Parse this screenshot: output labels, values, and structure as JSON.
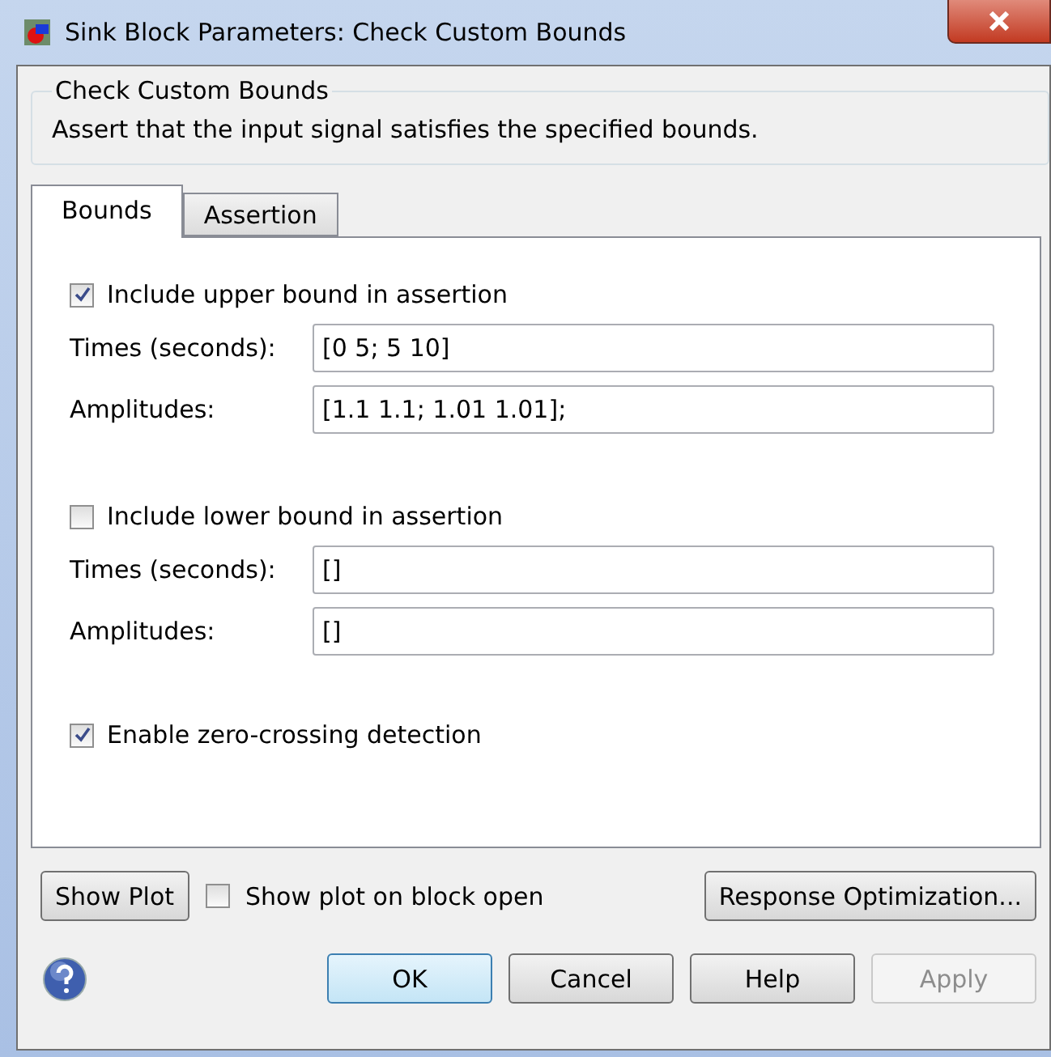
{
  "window": {
    "title": "Sink Block Parameters: Check Custom Bounds"
  },
  "description_group": {
    "title": "Check Custom Bounds",
    "text": "Assert that the input signal satisfies the specified bounds."
  },
  "tabs": [
    {
      "label": "Bounds",
      "selected": true
    },
    {
      "label": "Assertion",
      "selected": false
    }
  ],
  "sections": [
    {
      "checkbox": {
        "label": "Include upper bound in assertion",
        "checked": true
      },
      "fields": [
        {
          "label": "Times (seconds):",
          "value": "[0 5; 5 10]"
        },
        {
          "label": "Amplitudes:",
          "value": "[1.1 1.1; 1.01 1.01];"
        }
      ]
    },
    {
      "checkbox": {
        "label": "Include lower bound in assertion",
        "checked": false
      },
      "fields": [
        {
          "label": "Times (seconds):",
          "value": "[]"
        },
        {
          "label": "Amplitudes:",
          "value": "[]"
        }
      ]
    }
  ],
  "zero_crossing": {
    "label": "Enable zero-crossing detection",
    "checked": true
  },
  "plot_row": {
    "show_plot": "Show Plot",
    "checkbox": {
      "label": "Show plot on block open",
      "checked": false
    },
    "response": "Response Optimization..."
  },
  "buttons": [
    {
      "label": "OK",
      "kind": "default",
      "disabled": false
    },
    {
      "label": "Cancel",
      "kind": "normal",
      "disabled": false
    },
    {
      "label": "Help",
      "kind": "normal",
      "disabled": false
    },
    {
      "label": "Apply",
      "kind": "normal",
      "disabled": true
    }
  ]
}
